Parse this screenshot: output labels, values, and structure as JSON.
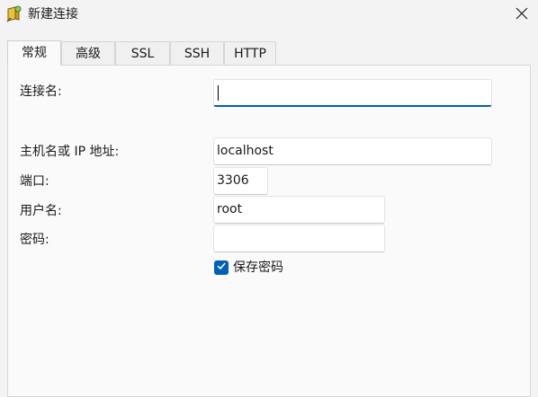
{
  "window": {
    "title": "新建连接"
  },
  "tabs": [
    "常规",
    "高级",
    "SSL",
    "SSH",
    "HTTP"
  ],
  "form": {
    "connection_name": {
      "label": "连接名:",
      "value": ""
    },
    "host": {
      "label": "主机名或 IP 地址:",
      "value": "localhost"
    },
    "port": {
      "label": "端口:",
      "value": "3306"
    },
    "username": {
      "label": "用户名:",
      "value": "root"
    },
    "password": {
      "label": "密码:",
      "value": ""
    },
    "save_password": {
      "label": "保存密码",
      "checked": true
    }
  },
  "colors": {
    "accent": "#005fb8",
    "background": "#f3f3f3",
    "panel": "#fafafa"
  },
  "icons": {
    "app": "database-plug-icon",
    "close": "close-icon",
    "check": "checkmark-icon"
  }
}
